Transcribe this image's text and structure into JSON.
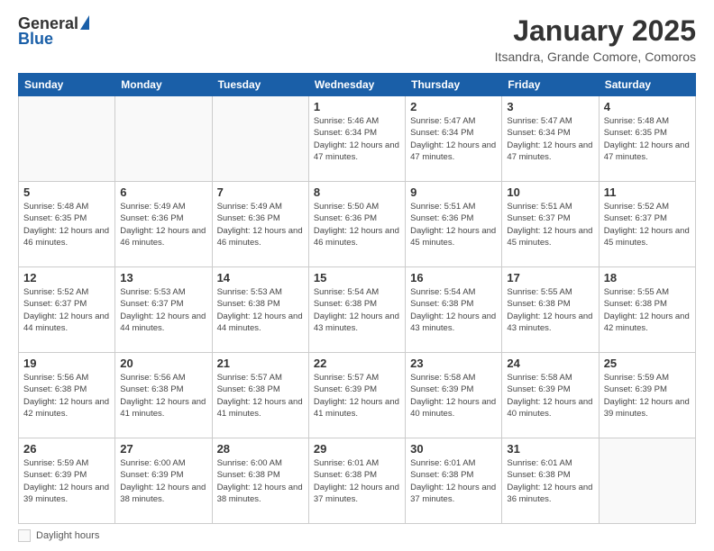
{
  "header": {
    "logo_general": "General",
    "logo_blue": "Blue",
    "main_title": "January 2025",
    "subtitle": "Itsandra, Grande Comore, Comoros"
  },
  "calendar": {
    "days_of_week": [
      "Sunday",
      "Monday",
      "Tuesday",
      "Wednesday",
      "Thursday",
      "Friday",
      "Saturday"
    ],
    "weeks": [
      [
        {
          "day": "",
          "info": ""
        },
        {
          "day": "",
          "info": ""
        },
        {
          "day": "",
          "info": ""
        },
        {
          "day": "1",
          "info": "Sunrise: 5:46 AM\nSunset: 6:34 PM\nDaylight: 12 hours\nand 47 minutes."
        },
        {
          "day": "2",
          "info": "Sunrise: 5:47 AM\nSunset: 6:34 PM\nDaylight: 12 hours\nand 47 minutes."
        },
        {
          "day": "3",
          "info": "Sunrise: 5:47 AM\nSunset: 6:34 PM\nDaylight: 12 hours\nand 47 minutes."
        },
        {
          "day": "4",
          "info": "Sunrise: 5:48 AM\nSunset: 6:35 PM\nDaylight: 12 hours\nand 47 minutes."
        }
      ],
      [
        {
          "day": "5",
          "info": "Sunrise: 5:48 AM\nSunset: 6:35 PM\nDaylight: 12 hours\nand 46 minutes."
        },
        {
          "day": "6",
          "info": "Sunrise: 5:49 AM\nSunset: 6:36 PM\nDaylight: 12 hours\nand 46 minutes."
        },
        {
          "day": "7",
          "info": "Sunrise: 5:49 AM\nSunset: 6:36 PM\nDaylight: 12 hours\nand 46 minutes."
        },
        {
          "day": "8",
          "info": "Sunrise: 5:50 AM\nSunset: 6:36 PM\nDaylight: 12 hours\nand 46 minutes."
        },
        {
          "day": "9",
          "info": "Sunrise: 5:51 AM\nSunset: 6:36 PM\nDaylight: 12 hours\nand 45 minutes."
        },
        {
          "day": "10",
          "info": "Sunrise: 5:51 AM\nSunset: 6:37 PM\nDaylight: 12 hours\nand 45 minutes."
        },
        {
          "day": "11",
          "info": "Sunrise: 5:52 AM\nSunset: 6:37 PM\nDaylight: 12 hours\nand 45 minutes."
        }
      ],
      [
        {
          "day": "12",
          "info": "Sunrise: 5:52 AM\nSunset: 6:37 PM\nDaylight: 12 hours\nand 44 minutes."
        },
        {
          "day": "13",
          "info": "Sunrise: 5:53 AM\nSunset: 6:37 PM\nDaylight: 12 hours\nand 44 minutes."
        },
        {
          "day": "14",
          "info": "Sunrise: 5:53 AM\nSunset: 6:38 PM\nDaylight: 12 hours\nand 44 minutes."
        },
        {
          "day": "15",
          "info": "Sunrise: 5:54 AM\nSunset: 6:38 PM\nDaylight: 12 hours\nand 43 minutes."
        },
        {
          "day": "16",
          "info": "Sunrise: 5:54 AM\nSunset: 6:38 PM\nDaylight: 12 hours\nand 43 minutes."
        },
        {
          "day": "17",
          "info": "Sunrise: 5:55 AM\nSunset: 6:38 PM\nDaylight: 12 hours\nand 43 minutes."
        },
        {
          "day": "18",
          "info": "Sunrise: 5:55 AM\nSunset: 6:38 PM\nDaylight: 12 hours\nand 42 minutes."
        }
      ],
      [
        {
          "day": "19",
          "info": "Sunrise: 5:56 AM\nSunset: 6:38 PM\nDaylight: 12 hours\nand 42 minutes."
        },
        {
          "day": "20",
          "info": "Sunrise: 5:56 AM\nSunset: 6:38 PM\nDaylight: 12 hours\nand 41 minutes."
        },
        {
          "day": "21",
          "info": "Sunrise: 5:57 AM\nSunset: 6:38 PM\nDaylight: 12 hours\nand 41 minutes."
        },
        {
          "day": "22",
          "info": "Sunrise: 5:57 AM\nSunset: 6:39 PM\nDaylight: 12 hours\nand 41 minutes."
        },
        {
          "day": "23",
          "info": "Sunrise: 5:58 AM\nSunset: 6:39 PM\nDaylight: 12 hours\nand 40 minutes."
        },
        {
          "day": "24",
          "info": "Sunrise: 5:58 AM\nSunset: 6:39 PM\nDaylight: 12 hours\nand 40 minutes."
        },
        {
          "day": "25",
          "info": "Sunrise: 5:59 AM\nSunset: 6:39 PM\nDaylight: 12 hours\nand 39 minutes."
        }
      ],
      [
        {
          "day": "26",
          "info": "Sunrise: 5:59 AM\nSunset: 6:39 PM\nDaylight: 12 hours\nand 39 minutes."
        },
        {
          "day": "27",
          "info": "Sunrise: 6:00 AM\nSunset: 6:39 PM\nDaylight: 12 hours\nand 38 minutes."
        },
        {
          "day": "28",
          "info": "Sunrise: 6:00 AM\nSunset: 6:38 PM\nDaylight: 12 hours\nand 38 minutes."
        },
        {
          "day": "29",
          "info": "Sunrise: 6:01 AM\nSunset: 6:38 PM\nDaylight: 12 hours\nand 37 minutes."
        },
        {
          "day": "30",
          "info": "Sunrise: 6:01 AM\nSunset: 6:38 PM\nDaylight: 12 hours\nand 37 minutes."
        },
        {
          "day": "31",
          "info": "Sunrise: 6:01 AM\nSunset: 6:38 PM\nDaylight: 12 hours\nand 36 minutes."
        },
        {
          "day": "",
          "info": ""
        }
      ]
    ]
  },
  "footer": {
    "legend_label": "Daylight hours"
  }
}
